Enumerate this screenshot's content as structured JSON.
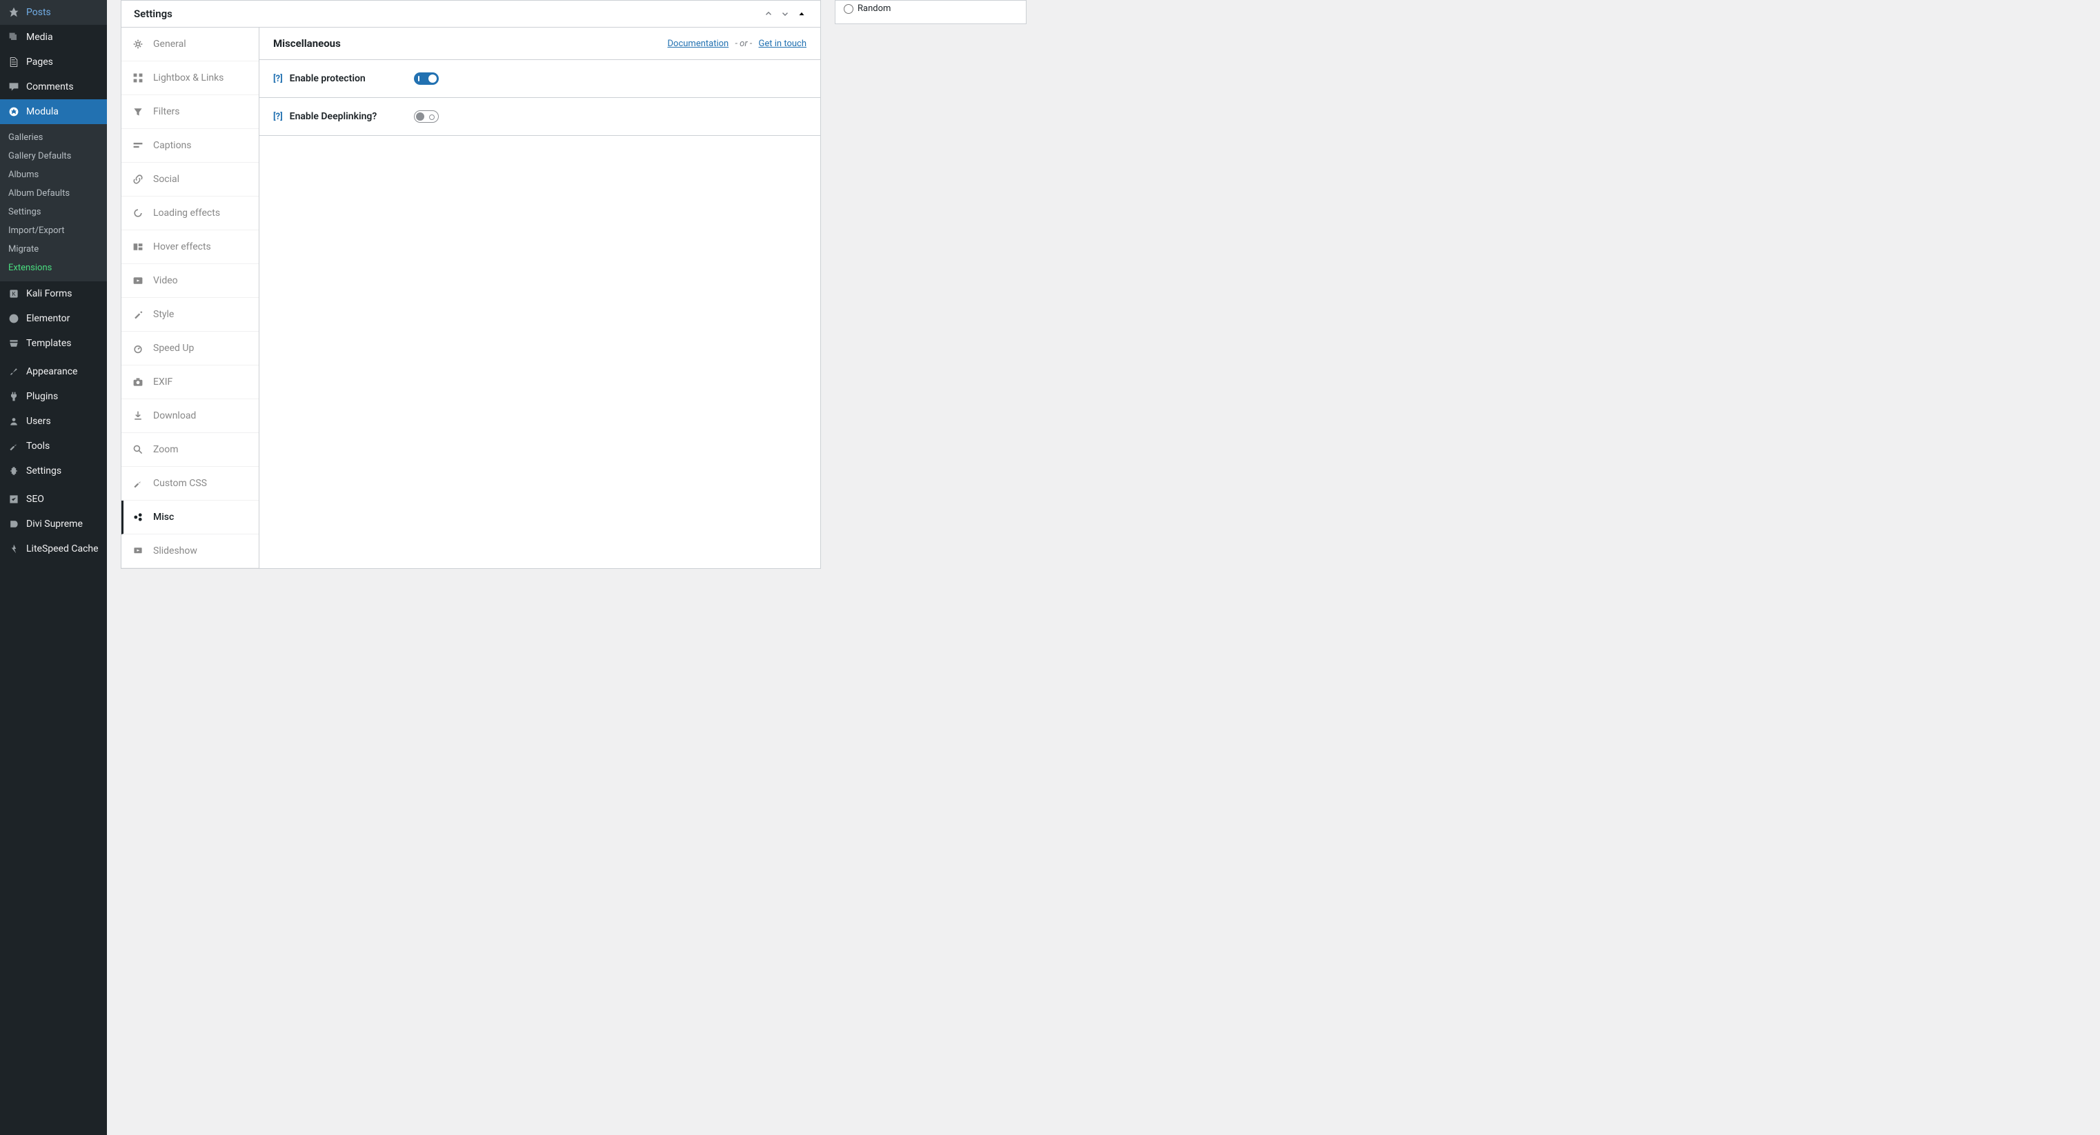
{
  "adminMenu": {
    "posts": "Posts",
    "media": "Media",
    "pages": "Pages",
    "comments": "Comments",
    "modula": "Modula",
    "kaliForms": "Kali Forms",
    "elementor": "Elementor",
    "templates": "Templates",
    "appearance": "Appearance",
    "plugins": "Plugins",
    "users": "Users",
    "tools": "Tools",
    "settings": "Settings",
    "seo": "SEO",
    "diviSupreme": "Divi Supreme",
    "litespeed": "LiteSpeed Cache"
  },
  "modulaSubmenu": {
    "galleries": "Galleries",
    "galleryDefaults": "Gallery Defaults",
    "albums": "Albums",
    "albumDefaults": "Album Defaults",
    "settings": "Settings",
    "importExport": "Import/Export",
    "migrate": "Migrate",
    "extensions": "Extensions"
  },
  "panel": {
    "title": "Settings"
  },
  "tabs": {
    "general": "General",
    "lightbox": "Lightbox & Links",
    "filters": "Filters",
    "captions": "Captions",
    "social": "Social",
    "loading": "Loading effects",
    "hover": "Hover effects",
    "video": "Video",
    "style": "Style",
    "speedup": "Speed Up",
    "exif": "EXIF",
    "download": "Download",
    "zoom": "Zoom",
    "customcss": "Custom CSS",
    "misc": "Misc",
    "slideshow": "Slideshow"
  },
  "content": {
    "title": "Miscellaneous",
    "docLink": "Documentation",
    "orSep": "- or -",
    "touchLink": "Get in touch",
    "help": "[?]",
    "enableProtection": "Enable protection",
    "enableDeeplinking": "Enable Deeplinking?"
  },
  "sideBox": {
    "random": "Random"
  }
}
